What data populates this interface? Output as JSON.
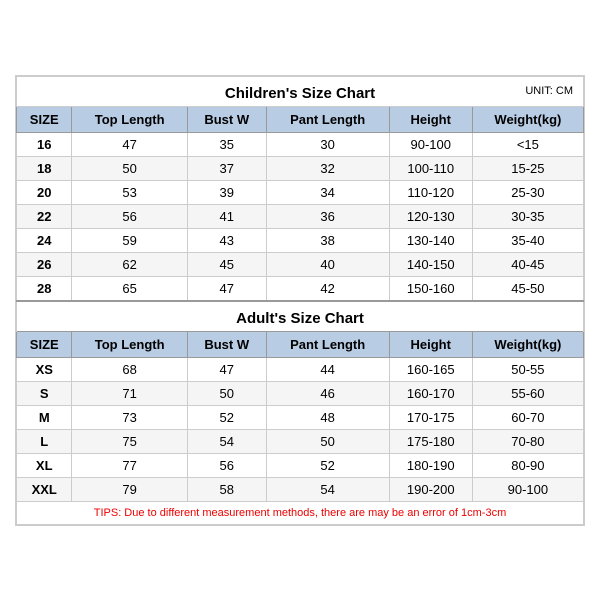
{
  "children_title": "Children's Size Chart",
  "adult_title": "Adult's Size Chart",
  "unit": "UNIT: CM",
  "headers": [
    "SIZE",
    "Top Length",
    "Bust W",
    "Pant Length",
    "Height",
    "Weight(kg)"
  ],
  "children_rows": [
    [
      "16",
      "47",
      "35",
      "30",
      "90-100",
      "<15"
    ],
    [
      "18",
      "50",
      "37",
      "32",
      "100-110",
      "15-25"
    ],
    [
      "20",
      "53",
      "39",
      "34",
      "110-120",
      "25-30"
    ],
    [
      "22",
      "56",
      "41",
      "36",
      "120-130",
      "30-35"
    ],
    [
      "24",
      "59",
      "43",
      "38",
      "130-140",
      "35-40"
    ],
    [
      "26",
      "62",
      "45",
      "40",
      "140-150",
      "40-45"
    ],
    [
      "28",
      "65",
      "47",
      "42",
      "150-160",
      "45-50"
    ]
  ],
  "adult_rows": [
    [
      "XS",
      "68",
      "47",
      "44",
      "160-165",
      "50-55"
    ],
    [
      "S",
      "71",
      "50",
      "46",
      "160-170",
      "55-60"
    ],
    [
      "M",
      "73",
      "52",
      "48",
      "170-175",
      "60-70"
    ],
    [
      "L",
      "75",
      "54",
      "50",
      "175-180",
      "70-80"
    ],
    [
      "XL",
      "77",
      "56",
      "52",
      "180-190",
      "80-90"
    ],
    [
      "XXL",
      "79",
      "58",
      "54",
      "190-200",
      "90-100"
    ]
  ],
  "tips": "TIPS: Due to different measurement methods, there are may be an error of 1cm-3cm"
}
